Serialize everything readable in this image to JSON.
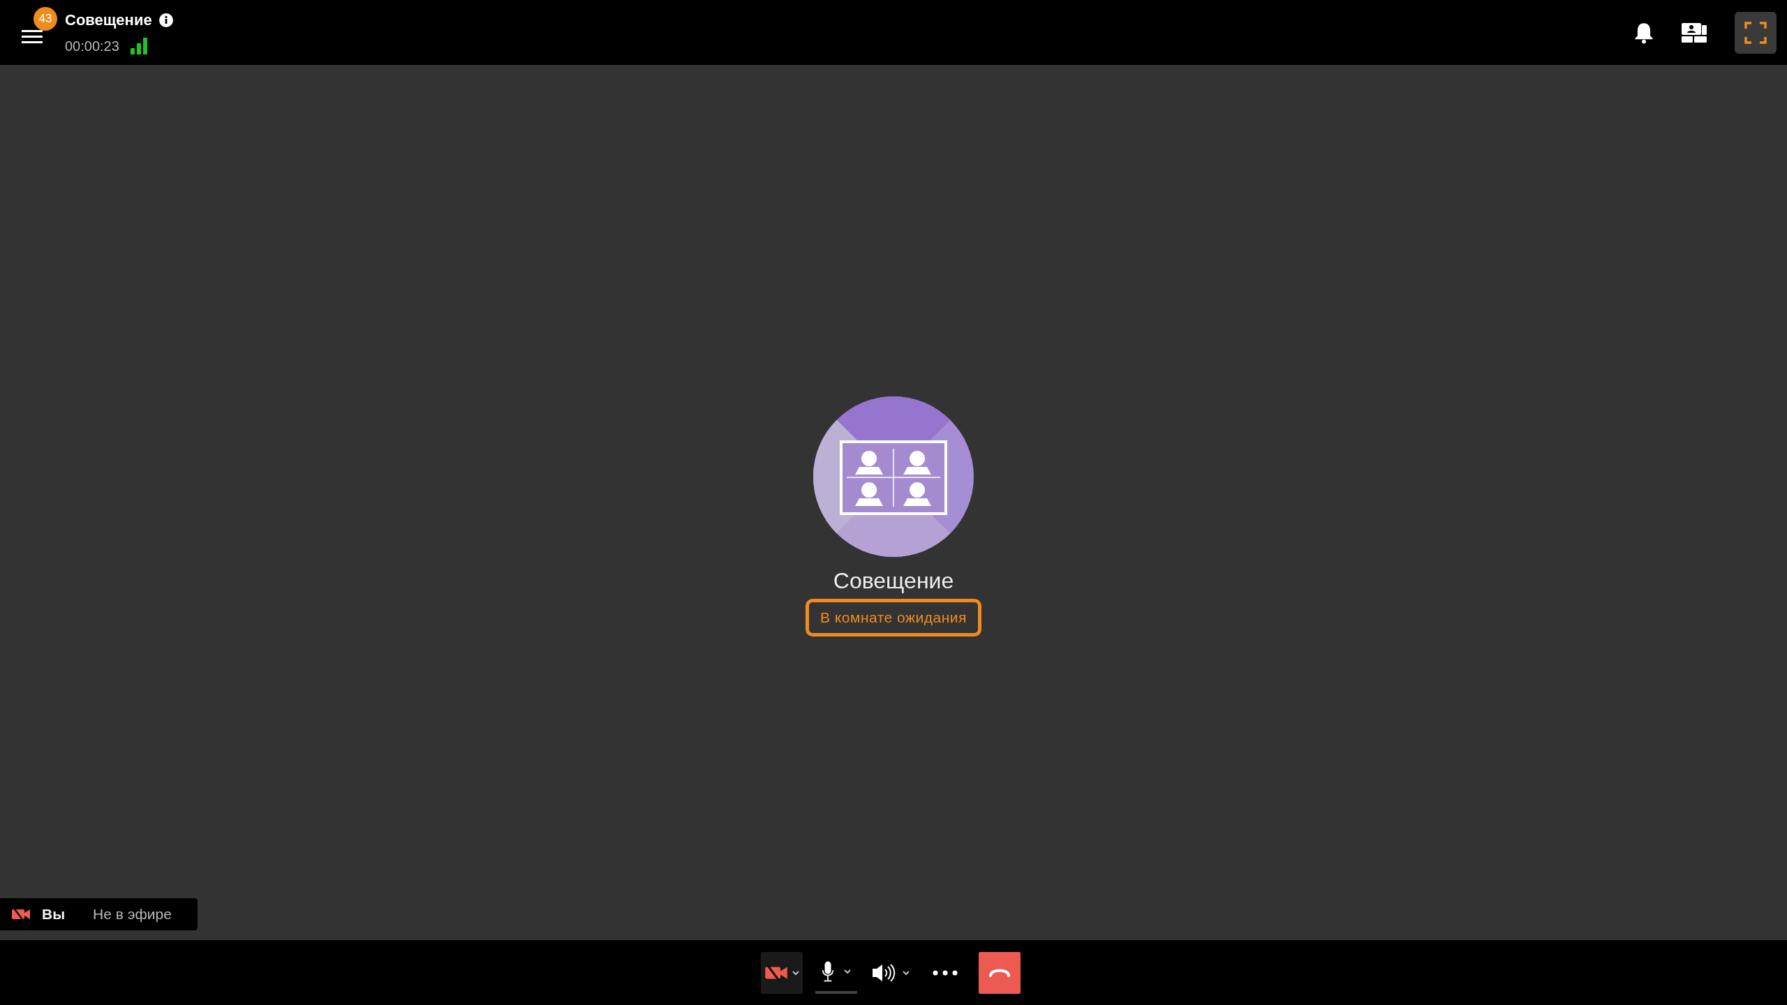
{
  "header": {
    "title": "Совещение",
    "badge": "43",
    "timer": "00:00:23"
  },
  "conference": {
    "name": "Совещение",
    "status": "В комнате ожидания"
  },
  "self_tile": {
    "name": "Вы",
    "state": "Не в эфире",
    "camera_off": true
  },
  "controls": {
    "camera_off": true
  }
}
